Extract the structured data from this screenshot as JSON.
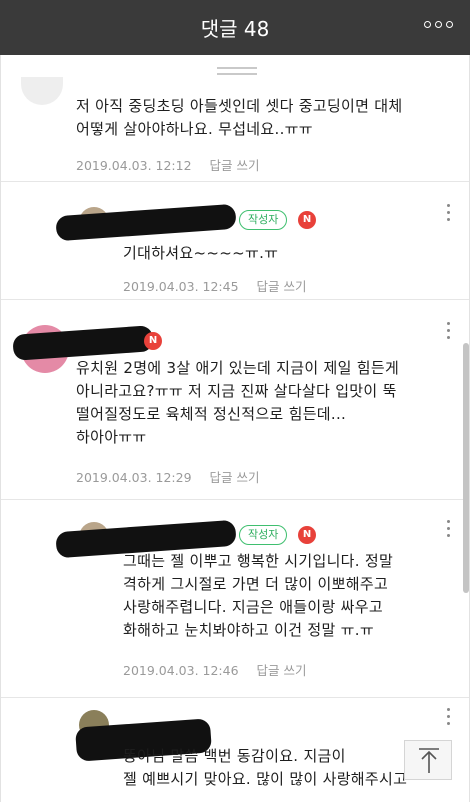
{
  "header": {
    "title": "댓글 48",
    "more_icon": "more-horizontal-icon"
  },
  "badges": {
    "author": "작성자",
    "naver": "N"
  },
  "comments": [
    {
      "text": "저 아직 중딩초딩 아들셋인데 셋다 중고딩이면 대체\n어떻게 살아야하나요. 무섭네요..ㅠㅠ",
      "date": "2019.04.03. 12:12",
      "reply": "답글 쓰기"
    },
    {
      "text": "기대하셔요~~~~ㅠ.ㅠ",
      "date": "2019.04.03. 12:45",
      "reply": "답글 쓰기"
    },
    {
      "text": "유치원 2명에 3살 애기 있는데 지금이 제일 힘든게\n아니라고요?ㅠㅠ 저 지금 진짜 살다살다 입맛이 뚝\n떨어질정도로 육체적 정신적으로 힘든데...\n하아아ㅠㅠ",
      "date": "2019.04.03. 12:29",
      "reply": "답글 쓰기"
    },
    {
      "text": "그때는 젤 이뿌고 행복한 시기입니다. 정말\n격하게 그시절로 가면 더 많이 이뽀해주고\n사랑해주렵니다. 지금은 애들이랑 싸우고\n화해하고 눈치봐야하고 이건 정말 ㅠ.ㅠ",
      "date": "2019.04.03. 12:46",
      "reply": "답글 쓰기"
    },
    {
      "text": "똥아님 말씀 백번 동감이요. 지금이\n젤 예쁘시기 맞아요. 많이 많이 사랑해주시고"
    }
  ]
}
